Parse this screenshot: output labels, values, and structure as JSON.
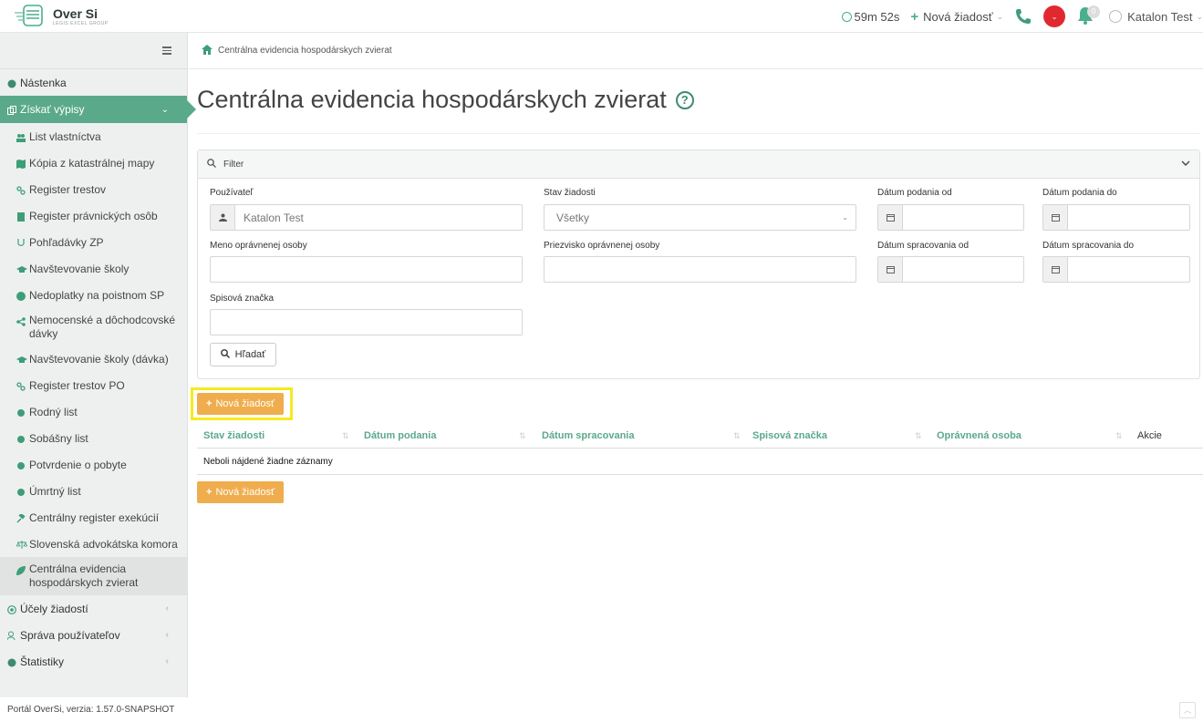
{
  "app": {
    "logo_title": "Over Si",
    "logo_subtitle": "LEGIS EXCEL GROUP"
  },
  "topbar": {
    "timer": "59m 52s",
    "new_request": "Nová žiadosť",
    "notifications_count": "0",
    "user_name": "Katalon Test"
  },
  "sidebar": {
    "items": [
      {
        "label": "Nástenka",
        "icon": "dashboard-icon"
      },
      {
        "label": "Získať výpisy",
        "icon": "copy-icon",
        "active": true
      },
      {
        "label": "List vlastníctva",
        "icon": "users-icon"
      },
      {
        "label": "Kópia z katastrálnej mapy",
        "icon": "map-icon"
      },
      {
        "label": "Register trestov",
        "icon": "link-icon"
      },
      {
        "label": "Register právnických osôb",
        "icon": "building-icon"
      },
      {
        "label": "Pohľadávky ZP",
        "icon": "health-icon"
      },
      {
        "label": "Navštevovanie školy",
        "icon": "graduation-cap-icon"
      },
      {
        "label": "Nedoplatky na poistnom SP",
        "icon": "info-circle-icon"
      },
      {
        "label": "Nemocenské a dôchodcovské dávky",
        "icon": "share-icon"
      },
      {
        "label": "Navštevovanie školy (dávka)",
        "icon": "graduation-cap-icon"
      },
      {
        "label": "Register trestov PO",
        "icon": "link-icon"
      },
      {
        "label": "Rodný list",
        "icon": "certificate-icon"
      },
      {
        "label": "Sobášny list",
        "icon": "certificate-icon"
      },
      {
        "label": "Potvrdenie o pobyte",
        "icon": "certificate-icon"
      },
      {
        "label": "Úmrtný list",
        "icon": "certificate-icon"
      },
      {
        "label": "Centrálny register exekúcií",
        "icon": "gavel-icon"
      },
      {
        "label": "Slovenská advokátska komora",
        "icon": "scales-icon"
      },
      {
        "label": "Centrálna evidencia hospodárskych zvierat",
        "icon": "leaf-icon"
      },
      {
        "label": "Účely žiadostí",
        "icon": "target-icon"
      },
      {
        "label": "Správa používateľov",
        "icon": "user-group-icon"
      },
      {
        "label": "Štatistiky",
        "icon": "chart-icon"
      }
    ],
    "footer": "Portál OverSi, verzia: 1.57.0-SNAPSHOT"
  },
  "breadcrumb": {
    "current": "Centrálna evidencia hospodárskych zvierat"
  },
  "page": {
    "title": "Centrálna evidencia hospodárskych zvierat",
    "help": "?"
  },
  "filter": {
    "title": "Filter",
    "labels": {
      "user": "Používateľ",
      "status": "Stav žiadosti",
      "date_submitted_from": "Dátum podania od",
      "date_submitted_to": "Dátum podania do",
      "first_name": "Meno oprávnenej osoby",
      "last_name": "Priezvisko oprávnenej osoby",
      "date_processed_from": "Dátum spracovania od",
      "date_processed_to": "Dátum spracovania do",
      "file_number": "Spisová značka"
    },
    "values": {
      "user": "Katalon Test",
      "status": "Všetky"
    },
    "search_button": "Hľadať"
  },
  "actions": {
    "new_request": "Nová žiadosť"
  },
  "table": {
    "columns": [
      "Stav žiadosti",
      "Dátum podania",
      "Dátum spracovania",
      "Spisová značka",
      "Oprávnená osoba",
      "Akcie"
    ],
    "empty_message": "Neboli nájdené žiadne záznamy"
  },
  "colors": {
    "accent": "#5aa98a",
    "orange": "#f0ad4e",
    "highlight": "#f5ea1e"
  }
}
